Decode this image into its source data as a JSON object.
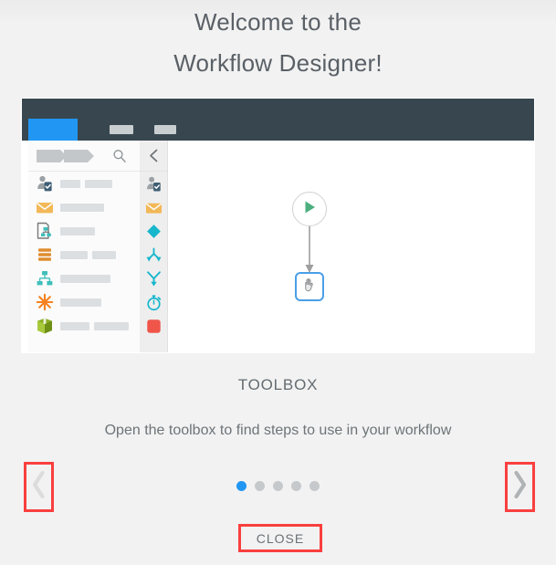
{
  "dialog": {
    "title_line1": "Welcome to the",
    "title_line2": "Workflow Designer!",
    "caption_heading": "TOOLBOX",
    "caption_text": "Open the toolbox to find steps to use in your workflow",
    "close_label": "CLOSE",
    "prev_icon": "chevron-left-icon",
    "next_icon": "chevron-right-icon",
    "highlight_color": "#f9403f"
  },
  "pagination": {
    "total": 5,
    "active_index": 0,
    "active_color": "#2196f3",
    "inactive_color": "#c6c9cb"
  },
  "illustration": {
    "app_header": {
      "background": "#38474f",
      "active_tab_color": "#2196f3",
      "placeholder_tabs": 2
    },
    "toolbox_panel": {
      "breadcrumb_icon": "breadcrumb-chevrons-icon",
      "search_icon": "search-icon",
      "items": [
        {
          "icon": "user-badge-icon",
          "bars": [
            22,
            30
          ]
        },
        {
          "icon": "envelope-icon",
          "bars": [
            48
          ]
        },
        {
          "icon": "document-flow-icon",
          "bars": [
            38
          ]
        },
        {
          "icon": "database-stack-icon",
          "bars": [
            30,
            26
          ]
        },
        {
          "icon": "org-chart-icon",
          "bars": [
            55
          ]
        },
        {
          "icon": "asterisk-icon",
          "bars": [
            45
          ]
        },
        {
          "icon": "cube-icon",
          "bars": [
            32,
            38
          ]
        }
      ]
    },
    "collapsed_rail": {
      "collapse_icon": "chevron-left-icon",
      "items": [
        "user-badge-icon",
        "envelope-icon",
        "diamond-icon",
        "merge-arrows-icon",
        "branch-y-icon",
        "stopwatch-icon",
        "stop-square-icon"
      ]
    },
    "canvas": {
      "start_node_icon": "play-icon",
      "start_node_color": "#4caf7d",
      "selected_node_icon": "hand-cursor-icon",
      "selected_node_border": "#4a9fe8",
      "connector_icon": "arrow-down-icon"
    }
  }
}
